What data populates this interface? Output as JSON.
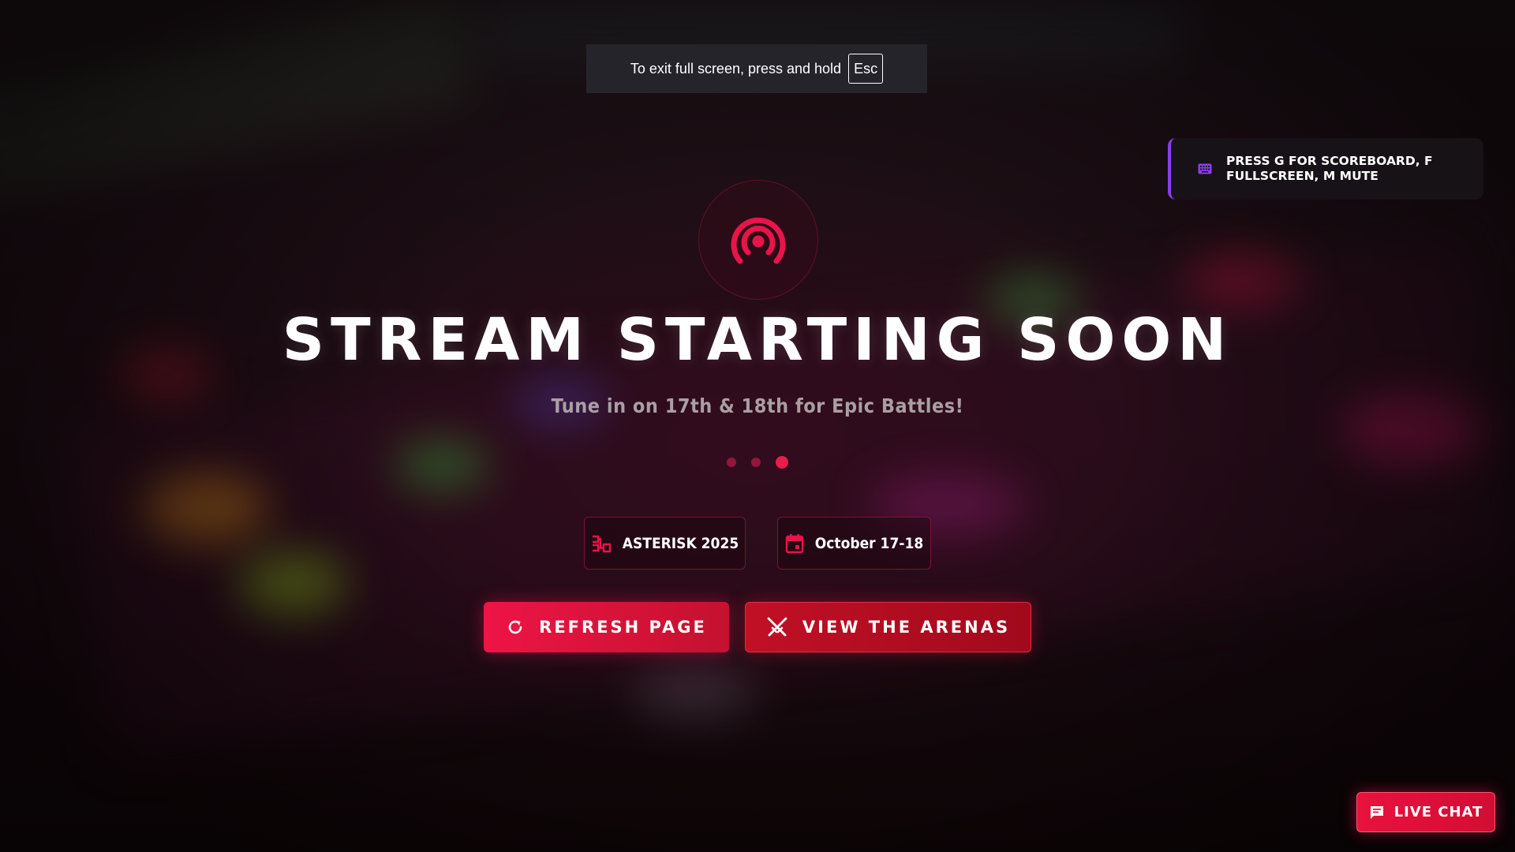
{
  "fullscreen_notice": {
    "text": "To exit full screen, press and hold",
    "key": "Esc"
  },
  "hint": {
    "icon": "keyboard-icon",
    "text": "Press G for scoreboard, F fullscreen, M mute"
  },
  "hero": {
    "icon": "broadcast-icon",
    "title": "STREAM STARTING SOON",
    "subtitle": "Tune in on 17th & 18th for Epic Battles!",
    "loader_dots": 3
  },
  "info_chips": [
    {
      "icon": "bracket-icon",
      "label": "ASTERISK 2025"
    },
    {
      "icon": "calendar-icon",
      "label": "October 17-18"
    }
  ],
  "buttons": {
    "refresh": {
      "icon": "refresh-icon",
      "label": "Refresh Page"
    },
    "arenas": {
      "icon": "crossed-swords-icon",
      "label": "View the Arenas"
    }
  },
  "live_chat": {
    "icon": "chat-icon",
    "label": "Live Chat"
  },
  "colors": {
    "accent": "#e61e4d",
    "accent_dark": "#a10a1c",
    "hint_border": "#8b3cf0",
    "subtitle": "#a99fa3"
  }
}
